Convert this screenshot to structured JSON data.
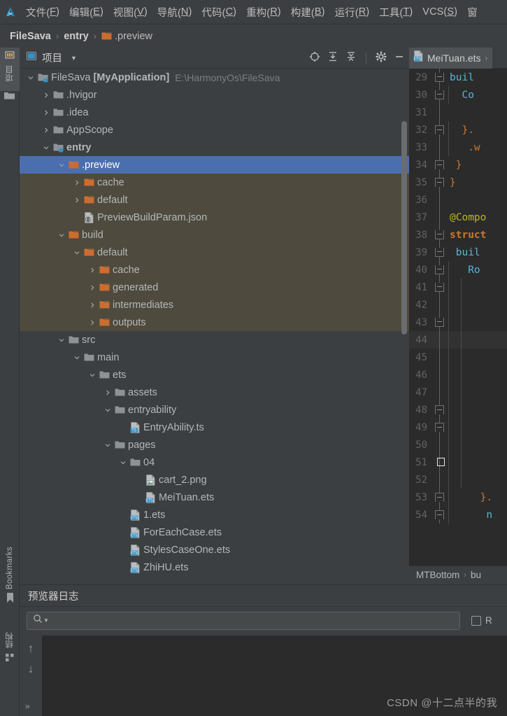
{
  "app": {
    "logo_icon": "deveco-logo-icon"
  },
  "menubar": {
    "items": [
      {
        "label": "文件(F)",
        "mnemonic": "F"
      },
      {
        "label": "编辑(E)",
        "mnemonic": "E"
      },
      {
        "label": "视图(V)",
        "mnemonic": "V"
      },
      {
        "label": "导航(N)",
        "mnemonic": "N"
      },
      {
        "label": "代码(C)",
        "mnemonic": "C"
      },
      {
        "label": "重构(R)",
        "mnemonic": "R"
      },
      {
        "label": "构建(B)",
        "mnemonic": "B"
      },
      {
        "label": "运行(R)",
        "mnemonic": "R"
      },
      {
        "label": "工具(T)",
        "mnemonic": "T"
      },
      {
        "label": "VCS(S)",
        "mnemonic": "S"
      },
      {
        "label": "窗",
        "mnemonic": ""
      }
    ]
  },
  "breadcrumb": {
    "segments": [
      {
        "label": "FileSava",
        "bold": true,
        "icon": ""
      },
      {
        "label": "entry",
        "bold": true,
        "icon": ""
      },
      {
        "label": ".preview",
        "bold": false,
        "icon": "folder-orange-icon"
      }
    ],
    "separator": "›"
  },
  "leftstrip": {
    "tabs": [
      {
        "label": "项目",
        "icon": "project-icon",
        "selected": true,
        "position": "top"
      },
      {
        "label": "Bookmarks",
        "icon": "bookmark-icon",
        "selected": false,
        "position": "bottom"
      },
      {
        "label": "结构",
        "icon": "structure-icon",
        "selected": false,
        "position": "bottom"
      }
    ]
  },
  "project_panel": {
    "title": "项目",
    "title_icon": "project-window-icon",
    "dropdown_icon": "chevron-down-icon",
    "actions": [
      {
        "name": "select-opened-file-icon",
        "tooltip": "选择打开的文件"
      },
      {
        "name": "expand-all-icon",
        "tooltip": "全部展开"
      },
      {
        "name": "collapse-all-icon",
        "tooltip": "全部折叠"
      },
      {
        "name": "settings-gear-icon",
        "tooltip": "设置"
      },
      {
        "name": "hide-icon",
        "tooltip": "隐藏"
      }
    ],
    "tree": [
      {
        "indent": 0,
        "arrow": "down",
        "icon": "module-icon",
        "label": "FileSava ",
        "bold_label": "[MyApplication]",
        "path": "E:\\HarmonyOs\\FileSava",
        "state": "normal"
      },
      {
        "indent": 1,
        "arrow": "right",
        "icon": "folder-gray-icon",
        "label": ".hvigor",
        "state": "normal"
      },
      {
        "indent": 1,
        "arrow": "right",
        "icon": "folder-gray-icon",
        "label": ".idea",
        "state": "normal"
      },
      {
        "indent": 1,
        "arrow": "right",
        "icon": "folder-gray-icon",
        "label": "AppScope",
        "state": "normal"
      },
      {
        "indent": 1,
        "arrow": "down",
        "icon": "module-icon",
        "label": "entry",
        "bold": true,
        "state": "normal"
      },
      {
        "indent": 2,
        "arrow": "down",
        "icon": "folder-orange-icon",
        "label": ".preview",
        "state": "selected"
      },
      {
        "indent": 3,
        "arrow": "right",
        "icon": "folder-orange-icon",
        "label": "cache",
        "state": "olive"
      },
      {
        "indent": 3,
        "arrow": "right",
        "icon": "folder-orange-icon",
        "label": "default",
        "state": "olive"
      },
      {
        "indent": 3,
        "arrow": "none",
        "icon": "json-file-icon",
        "label": "PreviewBuildParam.json",
        "state": "olive"
      },
      {
        "indent": 2,
        "arrow": "down",
        "icon": "folder-orange-icon",
        "label": "build",
        "state": "olive"
      },
      {
        "indent": 3,
        "arrow": "down",
        "icon": "folder-orange-icon",
        "label": "default",
        "state": "olive"
      },
      {
        "indent": 4,
        "arrow": "right",
        "icon": "folder-orange-icon",
        "label": "cache",
        "state": "olive"
      },
      {
        "indent": 4,
        "arrow": "right",
        "icon": "folder-orange-icon",
        "label": "generated",
        "state": "olive"
      },
      {
        "indent": 4,
        "arrow": "right",
        "icon": "folder-orange-icon",
        "label": "intermediates",
        "state": "olive"
      },
      {
        "indent": 4,
        "arrow": "right",
        "icon": "folder-orange-icon",
        "label": "outputs",
        "state": "olive"
      },
      {
        "indent": 2,
        "arrow": "down",
        "icon": "folder-gray-icon",
        "label": "src",
        "state": "normal"
      },
      {
        "indent": 3,
        "arrow": "down",
        "icon": "folder-gray-icon",
        "label": "main",
        "state": "normal"
      },
      {
        "indent": 4,
        "arrow": "down",
        "icon": "folder-gray-icon",
        "label": "ets",
        "state": "normal"
      },
      {
        "indent": 5,
        "arrow": "right",
        "icon": "folder-gray-icon",
        "label": "assets",
        "state": "normal"
      },
      {
        "indent": 5,
        "arrow": "down",
        "icon": "folder-gray-icon",
        "label": "entryability",
        "state": "normal"
      },
      {
        "indent": 6,
        "arrow": "none",
        "icon": "ts-file-icon",
        "label": "EntryAbility.ts",
        "state": "normal"
      },
      {
        "indent": 5,
        "arrow": "down",
        "icon": "folder-gray-icon",
        "label": "pages",
        "state": "normal"
      },
      {
        "indent": 6,
        "arrow": "down",
        "icon": "folder-gray-icon",
        "label": "04",
        "state": "normal"
      },
      {
        "indent": 7,
        "arrow": "none",
        "icon": "png-file-icon",
        "label": "cart_2.png",
        "state": "normal"
      },
      {
        "indent": 7,
        "arrow": "none",
        "icon": "ets-file-icon",
        "label": "MeiTuan.ets",
        "state": "normal"
      },
      {
        "indent": 6,
        "arrow": "none",
        "icon": "ets-file-icon",
        "label": "1.ets",
        "state": "normal"
      },
      {
        "indent": 6,
        "arrow": "none",
        "icon": "ets-file-icon",
        "label": "ForEachCase.ets",
        "state": "normal"
      },
      {
        "indent": 6,
        "arrow": "none",
        "icon": "ets-file-icon",
        "label": "StylesCaseOne.ets",
        "state": "normal"
      },
      {
        "indent": 6,
        "arrow": "none",
        "icon": "ets-file-icon",
        "label": "ZhiHU.ets",
        "state": "normal"
      }
    ]
  },
  "editor": {
    "tab": {
      "label": "MeiTuan.ets",
      "icon": "ets-file-icon",
      "chevron": "›"
    },
    "breadcrumb": {
      "segments": [
        "MTBottom",
        "bu"
      ],
      "separator": "›"
    },
    "current_line": 44,
    "lines": [
      {
        "num": 29,
        "fold": "down",
        "indent_guides": [],
        "text": "buil",
        "cls": "k-blue"
      },
      {
        "num": 30,
        "fold": "down",
        "indent_guides": [
          56
        ],
        "text": "  Co",
        "cls": "k-blue"
      },
      {
        "num": 31,
        "fold": "none",
        "indent_guides": [],
        "text": "",
        "cls": "k-white"
      },
      {
        "num": 32,
        "fold": "up",
        "indent_guides": [
          56
        ],
        "text": "  }.",
        "cls": "k-orange"
      },
      {
        "num": 33,
        "fold": "none",
        "indent_guides": [
          56
        ],
        "text": "   .w",
        "cls": "k-orange"
      },
      {
        "num": 34,
        "fold": "up",
        "indent_guides": [],
        "text": " }",
        "cls": "k-orange"
      },
      {
        "num": 35,
        "fold": "up",
        "indent_guides": [],
        "text": "}",
        "cls": "k-orange"
      },
      {
        "num": 36,
        "fold": "none",
        "indent_guides": [],
        "text": "",
        "cls": "k-white"
      },
      {
        "num": 37,
        "fold": "none",
        "indent_guides": [],
        "text": "@Compo",
        "cls": "k-yellow"
      },
      {
        "num": 38,
        "fold": "down",
        "indent_guides": [],
        "text": "struct",
        "cls": "k-orange k-bold"
      },
      {
        "num": 39,
        "fold": "down",
        "indent_guides": [],
        "text": " buil",
        "cls": "k-blue"
      },
      {
        "num": 40,
        "fold": "down",
        "indent_guides": [
          56
        ],
        "text": "   Ro",
        "cls": "k-blue"
      },
      {
        "num": 41,
        "fold": "down",
        "indent_guides": [
          56,
          74
        ],
        "text": "",
        "cls": "k-white"
      },
      {
        "num": 42,
        "fold": "none",
        "indent_guides": [
          56,
          74
        ],
        "text": "",
        "cls": "k-white"
      },
      {
        "num": 43,
        "fold": "down",
        "indent_guides": [
          56,
          74
        ],
        "text": "",
        "cls": "k-white"
      },
      {
        "num": 44,
        "fold": "none",
        "indent_guides": [
          56,
          74
        ],
        "text": "",
        "cls": "k-white"
      },
      {
        "num": 45,
        "fold": "none",
        "indent_guides": [
          56,
          74
        ],
        "text": "",
        "cls": "k-white"
      },
      {
        "num": 46,
        "fold": "none",
        "indent_guides": [
          56,
          74
        ],
        "text": "",
        "cls": "k-white"
      },
      {
        "num": 47,
        "fold": "none",
        "indent_guides": [
          56,
          74
        ],
        "text": "",
        "cls": "k-white"
      },
      {
        "num": 48,
        "fold": "up",
        "indent_guides": [
          56,
          74
        ],
        "text": "",
        "cls": "k-white"
      },
      {
        "num": 49,
        "fold": "up",
        "indent_guides": [
          56,
          74
        ],
        "text": "",
        "cls": "k-white"
      },
      {
        "num": 50,
        "fold": "none",
        "indent_guides": [
          56,
          74
        ],
        "text": "",
        "cls": "k-white"
      },
      {
        "num": 51,
        "fold": "none",
        "indent_guides": [
          56,
          74
        ],
        "text": "",
        "cls": "k-white",
        "caret": true
      },
      {
        "num": 52,
        "fold": "none",
        "indent_guides": [
          56,
          74
        ],
        "text": "",
        "cls": "k-white"
      },
      {
        "num": 53,
        "fold": "up",
        "indent_guides": [
          56
        ],
        "text": "     }.",
        "cls": "k-orange"
      },
      {
        "num": 54,
        "fold": "up",
        "indent_guides": [
          56
        ],
        "text": "      n",
        "cls": "k-blue"
      }
    ]
  },
  "log_panel": {
    "title": "预览器日志",
    "search": {
      "placeholder": "",
      "value": "",
      "icon": "search-icon",
      "dropdown_icon": "chevron-down-small-icon"
    },
    "filter_checkbox": {
      "label": "R",
      "checked": false
    },
    "gutter_actions": [
      {
        "name": "scroll-up-icon",
        "glyph": "↑"
      },
      {
        "name": "scroll-down-icon",
        "glyph": "↓"
      },
      {
        "name": "expand-more-icon",
        "glyph": "»"
      }
    ],
    "watermark": "CSDN @十二点半的我"
  },
  "colors": {
    "bg_panel": "#3c3f41",
    "bg_editor": "#2b2b2b",
    "selection_blue": "#4b6eaf",
    "olive_highlight": "#4e4a3d",
    "folder_orange": "#cb6c30",
    "folder_gray": "#8c9296",
    "text_primary": "#b4b7ba",
    "text_muted": "#7c7f82",
    "accent_cyan": "#56b6d4"
  }
}
